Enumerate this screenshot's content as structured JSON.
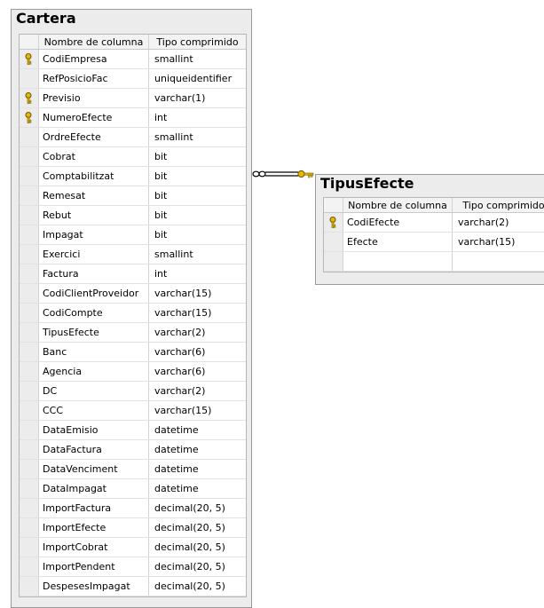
{
  "tables": [
    {
      "name": "Cartera",
      "columns_header": [
        "Nombre de columna",
        "Tipo comprimido"
      ],
      "rows": [
        {
          "name": "CodiEmpresa",
          "type": "smallint",
          "pk": true
        },
        {
          "name": "RefPosicioFac",
          "type": "uniqueidentifier",
          "pk": false
        },
        {
          "name": "Previsio",
          "type": "varchar(1)",
          "pk": true
        },
        {
          "name": "NumeroEfecte",
          "type": "int",
          "pk": true
        },
        {
          "name": "OrdreEfecte",
          "type": "smallint",
          "pk": false
        },
        {
          "name": "Cobrat",
          "type": "bit",
          "pk": false
        },
        {
          "name": "Comptabilitzat",
          "type": "bit",
          "pk": false
        },
        {
          "name": "Remesat",
          "type": "bit",
          "pk": false
        },
        {
          "name": "Rebut",
          "type": "bit",
          "pk": false
        },
        {
          "name": "Impagat",
          "type": "bit",
          "pk": false
        },
        {
          "name": "Exercici",
          "type": "smallint",
          "pk": false
        },
        {
          "name": "Factura",
          "type": "int",
          "pk": false
        },
        {
          "name": "CodiClientProveidor",
          "type": "varchar(15)",
          "pk": false
        },
        {
          "name": "CodiCompte",
          "type": "varchar(15)",
          "pk": false
        },
        {
          "name": "TipusEfecte",
          "type": "varchar(2)",
          "pk": false
        },
        {
          "name": "Banc",
          "type": "varchar(6)",
          "pk": false
        },
        {
          "name": "Agencia",
          "type": "varchar(6)",
          "pk": false
        },
        {
          "name": "DC",
          "type": "varchar(2)",
          "pk": false
        },
        {
          "name": "CCC",
          "type": "varchar(15)",
          "pk": false
        },
        {
          "name": "DataEmisio",
          "type": "datetime",
          "pk": false
        },
        {
          "name": "DataFactura",
          "type": "datetime",
          "pk": false
        },
        {
          "name": "DataVenciment",
          "type": "datetime",
          "pk": false
        },
        {
          "name": "DataImpagat",
          "type": "datetime",
          "pk": false
        },
        {
          "name": "ImportFactura",
          "type": "decimal(20, 5)",
          "pk": false
        },
        {
          "name": "ImportEfecte",
          "type": "decimal(20, 5)",
          "pk": false
        },
        {
          "name": "ImportCobrat",
          "type": "decimal(20, 5)",
          "pk": false
        },
        {
          "name": "ImportPendent",
          "type": "decimal(20, 5)",
          "pk": false
        },
        {
          "name": "DespesesImpagat",
          "type": "decimal(20, 5)",
          "pk": false
        }
      ]
    },
    {
      "name": "TipusEfecte",
      "columns_header": [
        "Nombre de columna",
        "Tipo comprimido"
      ],
      "rows": [
        {
          "name": "CodiEfecte",
          "type": "varchar(2)",
          "pk": true
        },
        {
          "name": "Efecte",
          "type": "varchar(15)",
          "pk": false
        },
        {
          "name": "",
          "type": "",
          "pk": false
        }
      ]
    }
  ],
  "colors": {
    "table_bg": "#ececec",
    "border": "#9a9a9a",
    "key_icon": "#e8b800",
    "relationship_line": "#000000"
  },
  "relationship": {
    "from_table": "Cartera",
    "to_table": "TipusEfecte",
    "from_end_icon": "infinity-icon",
    "to_end_icon": "key-icon"
  }
}
